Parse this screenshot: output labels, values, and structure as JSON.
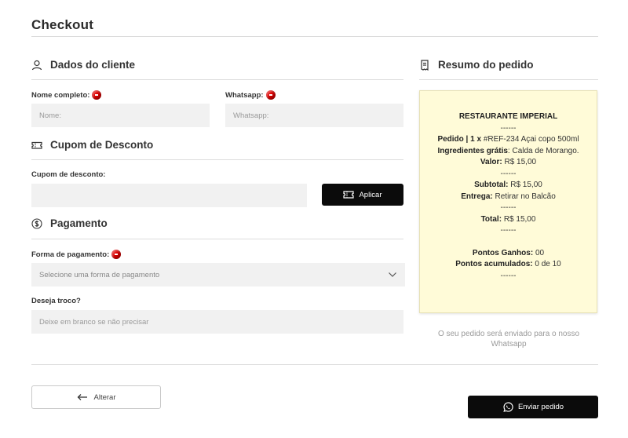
{
  "page": {
    "title": "Checkout"
  },
  "customer": {
    "heading": "Dados do cliente",
    "name_label": "Nome completo:",
    "name_placeholder": "Nome:",
    "whatsapp_label": "Whatsapp:",
    "whatsapp_placeholder": "Whatsapp:"
  },
  "coupon": {
    "heading": "Cupom de Desconto",
    "label": "Cupom de desconto:",
    "placeholder": "",
    "apply_label": "Aplicar"
  },
  "payment": {
    "heading": "Pagamento",
    "method_label": "Forma de pagamento:",
    "method_selected": "Selecione uma forma de pagamento",
    "change_label": "Deseja troco?",
    "change_placeholder": "Deixe em branco se não precisar"
  },
  "summary": {
    "heading": "Resumo do pedido",
    "restaurant": "RESTAURANTE IMPERIAL",
    "divider": "------",
    "order_label": "Pedido | 1 x",
    "order_value": "#REF-234 Açai copo 500ml",
    "ingredients_label": "Ingredientes grátis",
    "ingredients_value": ": Calda de Morango.",
    "item_value_label": "Valor:",
    "item_value": "R$ 15,00",
    "subtotal_label": "Subtotal:",
    "subtotal_value": "R$ 15,00",
    "delivery_label": "Entrega:",
    "delivery_value": "Retirar no Balcão",
    "total_label": "Total:",
    "total_value": "R$ 15,00",
    "points_earned_label": "Pontos Ganhos:",
    "points_earned_value": "00",
    "points_total_label": "Pontos acumulados:",
    "points_total_value": "0 de 10",
    "note": "O seu pedido será enviado para o nosso Whatsapp"
  },
  "actions": {
    "back_label": "Alterar",
    "send_label": "Enviar pedido"
  },
  "colors": {
    "required": "#e00000",
    "button_dark": "#0b0b0b",
    "receipt_bg": "#fffbd8"
  }
}
